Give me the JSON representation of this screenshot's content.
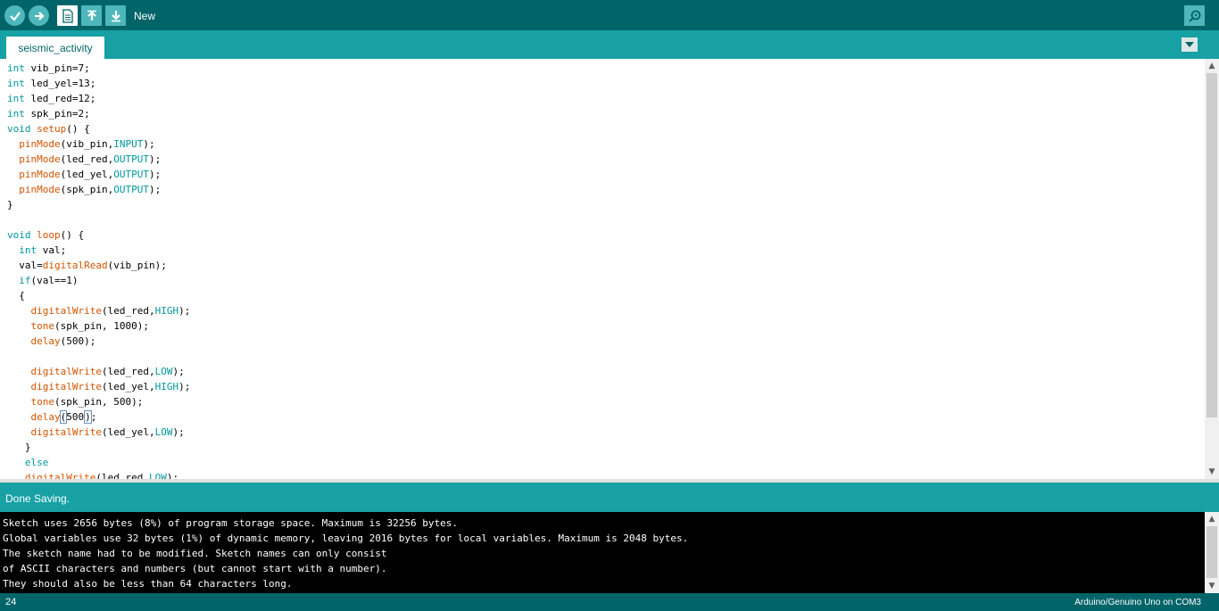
{
  "toolbar": {
    "buttons": [
      {
        "name": "verify",
        "icon": "checkmark-icon"
      },
      {
        "name": "upload",
        "icon": "arrow-right-icon"
      },
      {
        "name": "new",
        "icon": "new-file-icon"
      },
      {
        "name": "open",
        "icon": "arrow-up-icon"
      },
      {
        "name": "save",
        "icon": "arrow-down-icon"
      }
    ],
    "hover_label": "New",
    "serial_monitor_icon": "magnifier-icon"
  },
  "tabs": {
    "active": "seismic_activity",
    "menu_icon": "triangle-down-icon"
  },
  "editor": {
    "lines": [
      [
        [
          "kw",
          "int"
        ],
        [
          "t",
          " vib_pin=7;"
        ]
      ],
      [
        [
          "kw",
          "int"
        ],
        [
          "t",
          " led_yel=13;"
        ]
      ],
      [
        [
          "kw",
          "int"
        ],
        [
          "t",
          " led_red=12;"
        ]
      ],
      [
        [
          "kw",
          "int"
        ],
        [
          "t",
          " spk_pin=2;"
        ]
      ],
      [
        [
          "kw",
          "void"
        ],
        [
          "t",
          " "
        ],
        [
          "fn",
          "setup"
        ],
        [
          "t",
          "() {"
        ]
      ],
      [
        [
          "t",
          "  "
        ],
        [
          "fn",
          "pinMode"
        ],
        [
          "t",
          "(vib_pin,"
        ],
        [
          "cn",
          "INPUT"
        ],
        [
          "t",
          ");"
        ]
      ],
      [
        [
          "t",
          "  "
        ],
        [
          "fn",
          "pinMode"
        ],
        [
          "t",
          "(led_red,"
        ],
        [
          "cn",
          "OUTPUT"
        ],
        [
          "t",
          ");"
        ]
      ],
      [
        [
          "t",
          "  "
        ],
        [
          "fn",
          "pinMode"
        ],
        [
          "t",
          "(led_yel,"
        ],
        [
          "cn",
          "OUTPUT"
        ],
        [
          "t",
          ");"
        ]
      ],
      [
        [
          "t",
          "  "
        ],
        [
          "fn",
          "pinMode"
        ],
        [
          "t",
          "(spk_pin,"
        ],
        [
          "cn",
          "OUTPUT"
        ],
        [
          "t",
          ");"
        ]
      ],
      [
        [
          "t",
          "}"
        ]
      ],
      [
        [
          "t",
          ""
        ]
      ],
      [
        [
          "kw",
          "void"
        ],
        [
          "t",
          " "
        ],
        [
          "fn",
          "loop"
        ],
        [
          "t",
          "() {"
        ]
      ],
      [
        [
          "t",
          "  "
        ],
        [
          "kw",
          "int"
        ],
        [
          "t",
          " val;"
        ]
      ],
      [
        [
          "t",
          "  val="
        ],
        [
          "fn",
          "digitalRead"
        ],
        [
          "t",
          "(vib_pin);"
        ]
      ],
      [
        [
          "t",
          "  "
        ],
        [
          "kw",
          "if"
        ],
        [
          "t",
          "(val==1)"
        ]
      ],
      [
        [
          "t",
          "  {"
        ]
      ],
      [
        [
          "t",
          "    "
        ],
        [
          "fn",
          "digitalWrite"
        ],
        [
          "t",
          "(led_red,"
        ],
        [
          "cn",
          "HIGH"
        ],
        [
          "t",
          ");"
        ]
      ],
      [
        [
          "t",
          "    "
        ],
        [
          "fn",
          "tone"
        ],
        [
          "t",
          "(spk_pin, 1000);"
        ]
      ],
      [
        [
          "t",
          "    "
        ],
        [
          "fn",
          "delay"
        ],
        [
          "t",
          "(500);"
        ]
      ],
      [
        [
          "t",
          ""
        ]
      ],
      [
        [
          "t",
          "    "
        ],
        [
          "fn",
          "digitalWrite"
        ],
        [
          "t",
          "(led_red,"
        ],
        [
          "cn",
          "LOW"
        ],
        [
          "t",
          ");"
        ]
      ],
      [
        [
          "t",
          "    "
        ],
        [
          "fn",
          "digitalWrite"
        ],
        [
          "t",
          "(led_yel,"
        ],
        [
          "cn",
          "HIGH"
        ],
        [
          "t",
          ");"
        ]
      ],
      [
        [
          "t",
          "    "
        ],
        [
          "fn",
          "tone"
        ],
        [
          "t",
          "(spk_pin, 500);"
        ]
      ],
      [
        [
          "t",
          "    "
        ],
        [
          "fn",
          "delay"
        ],
        [
          "brk",
          "("
        ],
        [
          "t",
          "500"
        ],
        [
          "cur",
          ""
        ],
        [
          "brk",
          ")"
        ],
        [
          "t",
          ";"
        ]
      ],
      [
        [
          "t",
          "    "
        ],
        [
          "fn",
          "digitalWrite"
        ],
        [
          "t",
          "(led_yel,"
        ],
        [
          "cn",
          "LOW"
        ],
        [
          "t",
          ");"
        ]
      ],
      [
        [
          "t",
          "   }"
        ]
      ],
      [
        [
          "t",
          "   "
        ],
        [
          "kw",
          "else"
        ]
      ],
      [
        [
          "t",
          "   "
        ],
        [
          "fn",
          "digitalWrite"
        ],
        [
          "t",
          "(led_red,"
        ],
        [
          "cn",
          "LOW"
        ],
        [
          "t",
          ");"
        ]
      ]
    ]
  },
  "status": {
    "message": "Done Saving."
  },
  "console": {
    "lines": [
      "Sketch uses 2656 bytes (8%) of program storage space. Maximum is 32256 bytes.",
      "Global variables use 32 bytes (1%) of dynamic memory, leaving 2016 bytes for local variables. Maximum is 2048 bytes.",
      "The sketch name had to be modified. Sketch names can only consist",
      "of ASCII characters and numbers (but cannot start with a number).",
      "They should also be less than 64 characters long."
    ]
  },
  "footer": {
    "line_number": "24",
    "board": "Arduino/Genuino Uno on COM3"
  },
  "colors": {
    "toolbar_bg": "#006468",
    "tabbar_bg": "#17a1a5",
    "keyword": "#00979c",
    "function": "#d35400"
  }
}
